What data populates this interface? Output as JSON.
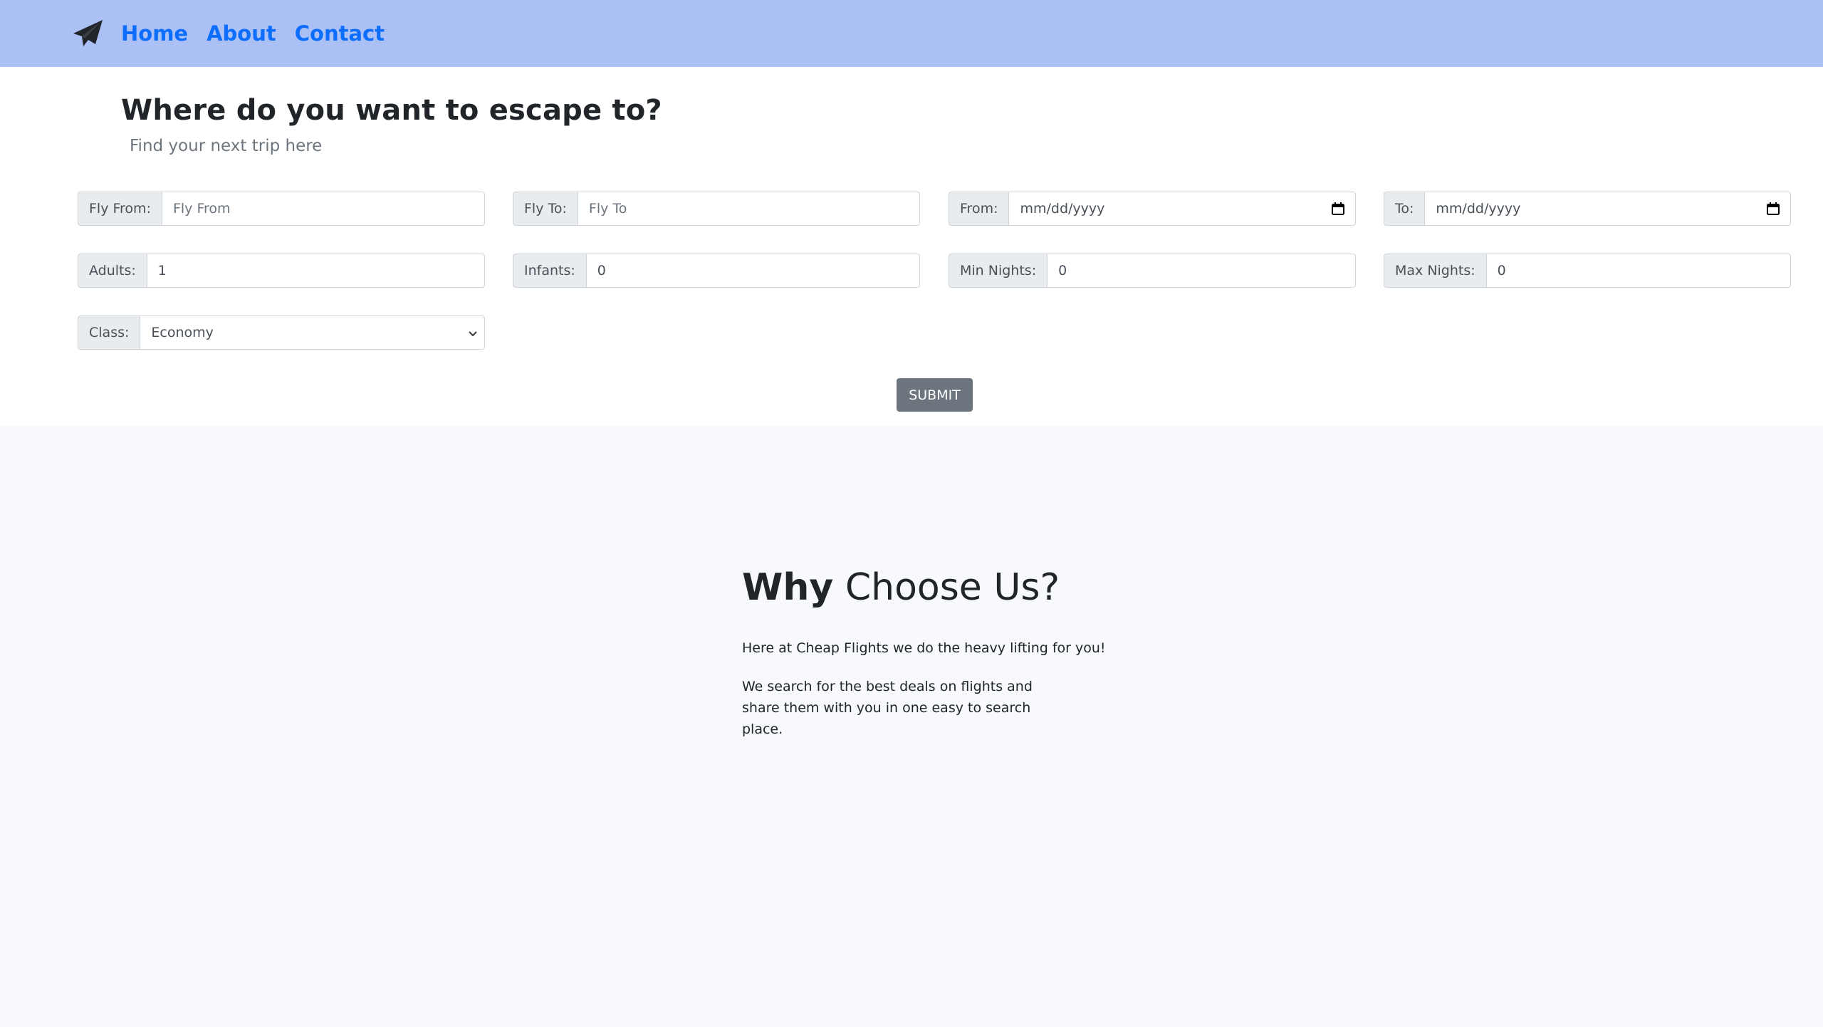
{
  "navbar": {
    "logo_icon": "paper-plane-icon",
    "links": [
      "Home",
      "About",
      "Contact"
    ]
  },
  "search": {
    "title": "Where do you want to escape to?",
    "subtitle": "Find your next trip here",
    "fly_from": {
      "label": "Fly From:",
      "placeholder": "Fly From"
    },
    "fly_to": {
      "label": "Fly To:",
      "placeholder": "Fly To"
    },
    "date_from": {
      "label": "From:",
      "value": "mm/dd/yyyy"
    },
    "date_to": {
      "label": "To:",
      "value": "mm/dd/yyyy"
    },
    "adults": {
      "label": "Adults:",
      "value": "1"
    },
    "infants": {
      "label": "Infants:",
      "value": "0"
    },
    "min_nights": {
      "label": "Min Nights:",
      "value": "0"
    },
    "max_nights": {
      "label": "Max Nights:",
      "value": "0"
    },
    "class": {
      "label": "Class:",
      "selected": "Economy"
    },
    "submit_label": "SUBMIT"
  },
  "why": {
    "title_bold": "Why",
    "title_rest": "Choose Us?",
    "paragraph1": "Here at Cheap Flights we do the heavy lifting for you!",
    "paragraph2": "We search for the best deals on flights and share them with you in one easy to search place."
  },
  "colors": {
    "navbar_bg": "#abc1f5",
    "link": "#0d6efd",
    "submit_bg": "#6c757d",
    "section_bg": "#f8f9fd"
  }
}
